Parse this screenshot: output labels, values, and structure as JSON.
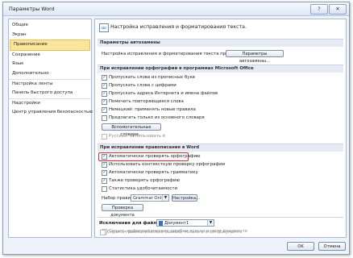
{
  "window": {
    "title": "Параметры Word",
    "controls": [
      "?",
      "✕"
    ]
  },
  "sidebar": {
    "items": [
      {
        "label": "Общие"
      },
      {
        "label": "Экран"
      },
      {
        "label": "Правописание",
        "selected": true
      },
      {
        "label": "Сохранение"
      },
      {
        "label": "Язык"
      },
      {
        "label": "Дополнительно"
      },
      {
        "label": "Настройка ленты"
      },
      {
        "label": "Панель быстрого доступа"
      },
      {
        "label": "Надстройки"
      },
      {
        "label": "Центр управления безопасностью"
      }
    ]
  },
  "content": {
    "header": "Настройка исправления и форматирования текста.",
    "autocorrect": {
      "section": "Параметры автозамены",
      "desc": "Настройка исправления и форматирования текста при вводе:",
      "button": "Параметры автозамены..."
    },
    "office_spelling": {
      "section": "При исправлении орфографии в программах Microsoft Office",
      "options": [
        {
          "label": "Пропускать слова из прописных букв",
          "checked": true
        },
        {
          "label": "Пропускать слова с цифрами",
          "checked": true
        },
        {
          "label": "Пропускать адреса Интернета и имена файлов",
          "checked": true
        },
        {
          "label": "Помечать повторяющиеся слова",
          "checked": true
        },
        {
          "label": "Немецкий: применять новые правила",
          "checked": true
        },
        {
          "label": "Предлагать только из основного словаря",
          "checked": false
        }
      ],
      "dictionaries_button": "Вспомогательные словари...",
      "russian_yo": {
        "label": "Русский: использовать ё",
        "checked": false
      }
    },
    "word_spelling": {
      "section": "При исправлении правописания в Word",
      "options": [
        {
          "label": "Автоматически проверять орфографию",
          "checked": true,
          "highlighted": true
        },
        {
          "label": "Использовать контекстную проверку орфографии",
          "checked": true
        },
        {
          "label": "Автоматически проверять грамматику",
          "checked": true
        },
        {
          "label": "Также проверять орфографию",
          "checked": true
        },
        {
          "label": "Статистика удобочитаемости",
          "checked": false
        }
      ],
      "ruleset_label": "Набор правил:",
      "ruleset_value": "Grammar Only",
      "settings_button": "Настройка...",
      "check_button": "Проверка документа"
    },
    "exceptions": {
      "label": "Исключения для файла:",
      "document": "Документ1",
      "options": [
        {
          "label": "Скрыть орфографические ошибки только в этом документе",
          "checked": false
        },
        {
          "label": "Скрыть грамматические ошибки только в этом документе",
          "checked": false
        }
      ]
    }
  },
  "footer": {
    "ok": "OK",
    "cancel": "Отмена"
  }
}
